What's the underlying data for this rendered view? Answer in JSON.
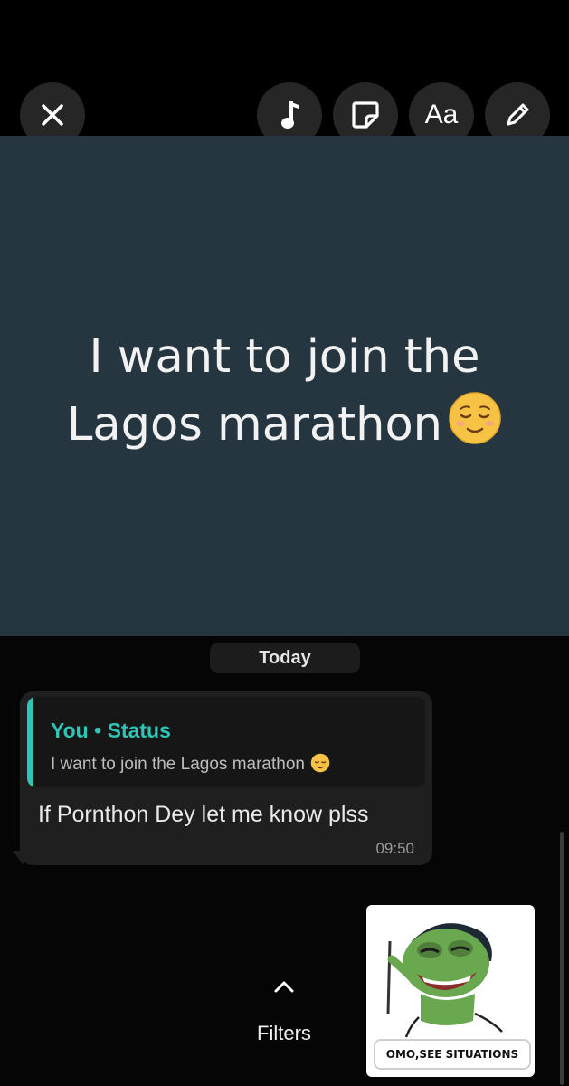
{
  "toolbar": {
    "close_icon": "close-icon",
    "music_icon": "music-note-icon",
    "sticker_icon": "sticker-icon",
    "text_label": "Aa",
    "pencil_icon": "pencil-icon"
  },
  "status": {
    "text_line1": "I want to join the",
    "text_line2": "Lagos marathon",
    "emoji": "relieved-face-emoji",
    "background_color": "#263641"
  },
  "chat": {
    "date_label": "Today",
    "reply": {
      "author": "You • Status",
      "quoted_text": "I want to join the Lagos marathon",
      "accent_color": "#2ec4b6"
    },
    "message": {
      "text": "If Pornthon Dey let me know plss",
      "time": "09:50"
    }
  },
  "filters": {
    "label": "Filters",
    "icon": "chevron-up-icon"
  },
  "sticker": {
    "caption": "OMO,SEE SITUATIONS",
    "character": "pepe-frog-sticker"
  }
}
